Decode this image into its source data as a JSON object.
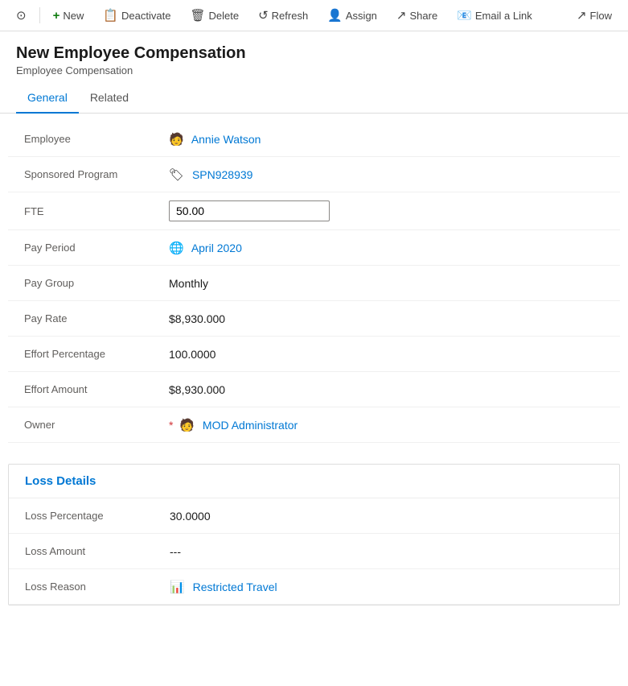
{
  "toolbar": {
    "buttons": [
      {
        "id": "back",
        "label": "",
        "icon": "⊙",
        "type": "back"
      },
      {
        "id": "new",
        "label": "New",
        "icon": "+",
        "type": "new"
      },
      {
        "id": "deactivate",
        "label": "Deactivate",
        "icon": "📄",
        "type": "deactivate"
      },
      {
        "id": "delete",
        "label": "Delete",
        "icon": "🗑",
        "type": "delete"
      },
      {
        "id": "refresh",
        "label": "Refresh",
        "icon": "↺",
        "type": "refresh"
      },
      {
        "id": "assign",
        "label": "Assign",
        "icon": "👤",
        "type": "assign"
      },
      {
        "id": "share",
        "label": "Share",
        "icon": "↗",
        "type": "share"
      },
      {
        "id": "email",
        "label": "Email a Link",
        "icon": "✉",
        "type": "email"
      },
      {
        "id": "flow",
        "label": "Flow",
        "icon": "⤴",
        "type": "flow"
      }
    ]
  },
  "page": {
    "title": "New Employee Compensation",
    "subtitle": "Employee Compensation"
  },
  "tabs": [
    {
      "id": "general",
      "label": "General",
      "active": true
    },
    {
      "id": "related",
      "label": "Related",
      "active": false
    }
  ],
  "fields": [
    {
      "label": "Employee",
      "type": "link",
      "value": "Annie Watson",
      "icon": "person",
      "required": false
    },
    {
      "label": "Sponsored Program",
      "type": "link",
      "value": "SPN928939",
      "icon": "grid",
      "required": false
    },
    {
      "label": "FTE",
      "type": "input",
      "value": "50.00",
      "required": false
    },
    {
      "label": "Pay Period",
      "type": "link",
      "value": "April 2020",
      "icon": "calendar",
      "required": false
    },
    {
      "label": "Pay Group",
      "type": "text",
      "value": "Monthly",
      "required": false
    },
    {
      "label": "Pay Rate",
      "type": "text",
      "value": "$8,930.000",
      "required": false
    },
    {
      "label": "Effort Percentage",
      "type": "text",
      "value": "100.0000",
      "required": false
    },
    {
      "label": "Effort Amount",
      "type": "text",
      "value": "$8,930.000",
      "required": false
    },
    {
      "label": "Owner",
      "type": "link",
      "value": "MOD Administrator",
      "icon": "person",
      "required": true
    }
  ],
  "loss_details": {
    "title": "Loss Details",
    "fields": [
      {
        "label": "Loss Percentage",
        "type": "text",
        "value": "30.0000"
      },
      {
        "label": "Loss Amount",
        "type": "text",
        "value": "---"
      },
      {
        "label": "Loss Reason",
        "type": "link",
        "value": "Restricted Travel",
        "icon": "chart"
      }
    ]
  },
  "icons": {
    "person": "🧑",
    "grid": "🏷",
    "calendar": "🌐",
    "chart": "📊",
    "new_plus": "+",
    "deactivate": "📋",
    "delete": "🗑",
    "refresh": "↺",
    "assign": "👤",
    "share": "↗",
    "email": "📧",
    "flow": "↗",
    "back": "⊙"
  }
}
